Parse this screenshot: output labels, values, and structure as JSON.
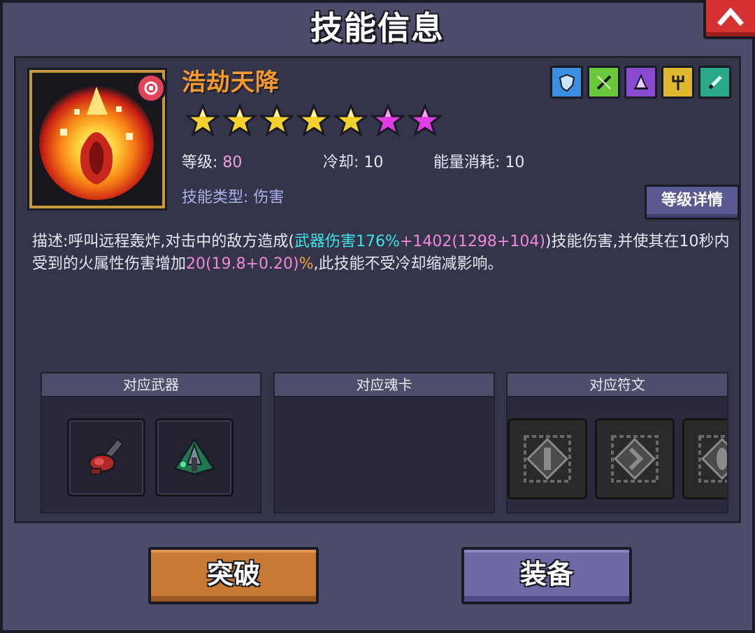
{
  "window": {
    "title": "技能信息"
  },
  "skill": {
    "name": "浩劫天降",
    "stars": {
      "gold": 5,
      "purple": 2
    },
    "level_label": "等级:",
    "level_value": "80",
    "cooldown_label": "冷却:",
    "cooldown_value": "10",
    "energy_label": "能量消耗:",
    "energy_value": "10",
    "type_label": "技能类型:",
    "type_value": "伤害",
    "level_detail_button": "等级详情",
    "elements": [
      {
        "icon": "shield-icon",
        "color": "#3a8fe0"
      },
      {
        "icon": "sword-icon",
        "color": "#6ac83a"
      },
      {
        "icon": "wizard-hat-icon",
        "color": "#8a4ad0"
      },
      {
        "icon": "trident-icon",
        "color": "#e0b830"
      },
      {
        "icon": "blade-icon",
        "color": "#2aa88a"
      }
    ]
  },
  "description": {
    "part1": "描述:呼叫远程轰炸,对击中的敌方造成(",
    "cyan": "武器伤害176%",
    "plus1": "+",
    "pink1": "1402(1298+104)",
    "part2": ")技能伤害,并使其在10秒内受到的火属性伤害增加",
    "pink2": "20(19.8+0.20)",
    "orange": "%",
    "part3": ",此技能不受冷却缩减影响。"
  },
  "slots": {
    "weapons_title": "对应武器",
    "soulcards_title": "对应魂卡",
    "runes_title": "对应符文"
  },
  "buttons": {
    "breakthrough": "突破",
    "equip": "装备"
  },
  "colors": {
    "skill_name": "#f59a2c",
    "highlight_cyan": "#3ee4e4",
    "highlight_pink": "#f08ad8",
    "highlight_orange": "#f5a23a",
    "breakthrough_button": "#c77a33",
    "equip_button": "#6e6aa8"
  }
}
